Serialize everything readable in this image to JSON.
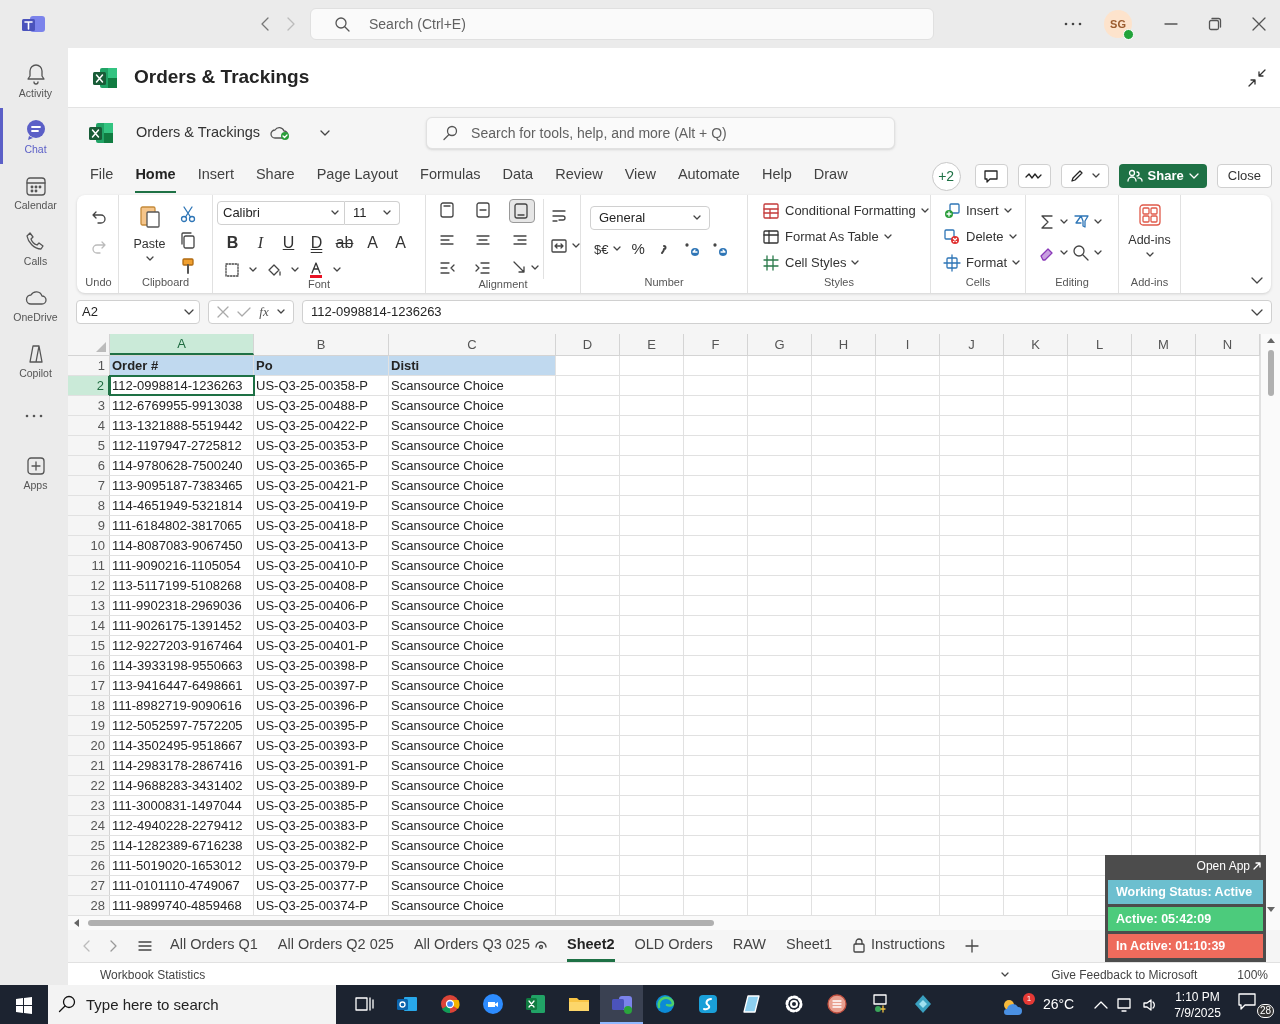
{
  "app_bar": {
    "search_placeholder": "Search (Ctrl+E)",
    "avatar_initials": "SG"
  },
  "rail": [
    {
      "label": "Activity",
      "selected": false
    },
    {
      "label": "Chat",
      "selected": true
    },
    {
      "label": "Calendar",
      "selected": false
    },
    {
      "label": "Calls",
      "selected": false
    },
    {
      "label": "OneDrive",
      "selected": false
    },
    {
      "label": "Copilot",
      "selected": false
    },
    {
      "label": "Apps",
      "selected": false
    }
  ],
  "header": {
    "title": "Orders & Trackings"
  },
  "workbook": {
    "name": "Orders & Trackings",
    "search_placeholder": "Search for tools, help, and more (Alt + Q)"
  },
  "menu_tabs": [
    {
      "label": "File",
      "selected": false
    },
    {
      "label": "Home",
      "selected": true
    },
    {
      "label": "Insert",
      "selected": false
    },
    {
      "label": "Share",
      "selected": false
    },
    {
      "label": "Page Layout",
      "selected": false
    },
    {
      "label": "Formulas",
      "selected": false
    },
    {
      "label": "Data",
      "selected": false
    },
    {
      "label": "Review",
      "selected": false
    },
    {
      "label": "View",
      "selected": false
    },
    {
      "label": "Automate",
      "selected": false
    },
    {
      "label": "Help",
      "selected": false
    },
    {
      "label": "Draw",
      "selected": false
    }
  ],
  "toolbar": {
    "coauthors": "+2",
    "share": "Share",
    "close": "Close"
  },
  "ribbon": {
    "paste": "Paste",
    "font_name": "Calibri",
    "font_size": "11",
    "font_buttons": [
      "B",
      "I",
      "U",
      "D",
      "ab",
      "A",
      "A"
    ],
    "number_format": "General",
    "currency": "$€",
    "percent": "%",
    "styles": [
      "Conditional Formatting",
      "Format As Table",
      "Cell Styles"
    ],
    "cells": [
      "Insert",
      "Delete",
      "Format"
    ],
    "addins": "Add-ins",
    "groups": [
      "Undo",
      "Clipboard",
      "Font",
      "Alignment",
      "Number",
      "Styles",
      "Cells",
      "Editing",
      "Add-ins"
    ]
  },
  "formula_bar": {
    "name_box": "A2",
    "fx": "fx",
    "value": "112-0998814-1236263"
  },
  "grid": {
    "columns": [
      {
        "label": "A",
        "selected": true
      },
      {
        "label": "B",
        "selected": false
      },
      {
        "label": "C",
        "selected": false
      },
      {
        "label": "D",
        "selected": false
      },
      {
        "label": "E",
        "selected": false
      },
      {
        "label": "F",
        "selected": false
      },
      {
        "label": "G",
        "selected": false
      },
      {
        "label": "H",
        "selected": false
      },
      {
        "label": "I",
        "selected": false
      },
      {
        "label": "J",
        "selected": false
      },
      {
        "label": "K",
        "selected": false
      },
      {
        "label": "L",
        "selected": false
      },
      {
        "label": "M",
        "selected": false
      },
      {
        "label": "N",
        "selected": false
      }
    ],
    "rows": [
      {
        "number": "1",
        "kind": "header",
        "selected": false,
        "cells": [
          "Order #",
          "Po",
          "Disti"
        ]
      },
      {
        "number": "2",
        "kind": "data",
        "selected": true,
        "cells": [
          "112-0998814-1236263",
          "US-Q3-25-00358-P",
          "Scansource Choice"
        ]
      },
      {
        "number": "3",
        "kind": "data",
        "selected": false,
        "cells": [
          "112-6769955-9913038",
          "US-Q3-25-00488-P",
          "Scansource Choice"
        ]
      },
      {
        "number": "4",
        "kind": "data",
        "selected": false,
        "cells": [
          "113-1321888-5519442",
          "US-Q3-25-00422-P",
          "Scansource Choice"
        ]
      },
      {
        "number": "5",
        "kind": "data",
        "selected": false,
        "cells": [
          "112-1197947-2725812",
          "US-Q3-25-00353-P",
          "Scansource Choice"
        ]
      },
      {
        "number": "6",
        "kind": "data",
        "selected": false,
        "cells": [
          "114-9780628-7500240",
          "US-Q3-25-00365-P",
          "Scansource Choice"
        ]
      },
      {
        "number": "7",
        "kind": "data",
        "selected": false,
        "cells": [
          "113-9095187-7383465",
          "US-Q3-25-00421-P",
          "Scansource Choice"
        ]
      },
      {
        "number": "8",
        "kind": "data",
        "selected": false,
        "cells": [
          "114-4651949-5321814",
          "US-Q3-25-00419-P",
          "Scansource Choice"
        ]
      },
      {
        "number": "9",
        "kind": "data",
        "selected": false,
        "cells": [
          "111-6184802-3817065",
          "US-Q3-25-00418-P",
          "Scansource Choice"
        ]
      },
      {
        "number": "10",
        "kind": "data",
        "selected": false,
        "cells": [
          "114-8087083-9067450",
          "US-Q3-25-00413-P",
          "Scansource Choice"
        ]
      },
      {
        "number": "11",
        "kind": "data",
        "selected": false,
        "cells": [
          "111-9090216-1105054",
          "US-Q3-25-00410-P",
          "Scansource Choice"
        ]
      },
      {
        "number": "12",
        "kind": "data",
        "selected": false,
        "cells": [
          "113-5117199-5108268",
          "US-Q3-25-00408-P",
          "Scansource Choice"
        ]
      },
      {
        "number": "13",
        "kind": "data",
        "selected": false,
        "cells": [
          "111-9902318-2969036",
          "US-Q3-25-00406-P",
          "Scansource Choice"
        ]
      },
      {
        "number": "14",
        "kind": "data",
        "selected": false,
        "cells": [
          "111-9026175-1391452",
          "US-Q3-25-00403-P",
          "Scansource Choice"
        ]
      },
      {
        "number": "15",
        "kind": "data",
        "selected": false,
        "cells": [
          "112-9227203-9167464",
          "US-Q3-25-00401-P",
          "Scansource Choice"
        ]
      },
      {
        "number": "16",
        "kind": "data",
        "selected": false,
        "cells": [
          "114-3933198-9550663",
          "US-Q3-25-00398-P",
          "Scansource Choice"
        ]
      },
      {
        "number": "17",
        "kind": "data",
        "selected": false,
        "cells": [
          "113-9416447-6498661",
          "US-Q3-25-00397-P",
          "Scansource Choice"
        ]
      },
      {
        "number": "18",
        "kind": "data",
        "selected": false,
        "cells": [
          "111-8982719-9090616",
          "US-Q3-25-00396-P",
          "Scansource Choice"
        ]
      },
      {
        "number": "19",
        "kind": "data",
        "selected": false,
        "cells": [
          "112-5052597-7572205",
          "US-Q3-25-00395-P",
          "Scansource Choice"
        ]
      },
      {
        "number": "20",
        "kind": "data",
        "selected": false,
        "cells": [
          "114-3502495-9518667",
          "US-Q3-25-00393-P",
          "Scansource Choice"
        ]
      },
      {
        "number": "21",
        "kind": "data",
        "selected": false,
        "cells": [
          "114-2983178-2867416",
          "US-Q3-25-00391-P",
          "Scansource Choice"
        ]
      },
      {
        "number": "22",
        "kind": "data",
        "selected": false,
        "cells": [
          "114-9688283-3431402",
          "US-Q3-25-00389-P",
          "Scansource Choice"
        ]
      },
      {
        "number": "23",
        "kind": "data",
        "selected": false,
        "cells": [
          "111-3000831-1497044",
          "US-Q3-25-00385-P",
          "Scansource Choice"
        ]
      },
      {
        "number": "24",
        "kind": "data",
        "selected": false,
        "cells": [
          "112-4940228-2279412",
          "US-Q3-25-00383-P",
          "Scansource Choice"
        ]
      },
      {
        "number": "25",
        "kind": "data",
        "selected": false,
        "cells": [
          "114-1282389-6716238",
          "US-Q3-25-00382-P",
          "Scansource Choice"
        ]
      },
      {
        "number": "26",
        "kind": "data",
        "selected": false,
        "cells": [
          "111-5019020-1653012",
          "US-Q3-25-00379-P",
          "Scansource Choice"
        ]
      },
      {
        "number": "27",
        "kind": "data",
        "selected": false,
        "cells": [
          "111-0101110-4749067",
          "US-Q3-25-00377-P",
          "Scansource Choice"
        ]
      },
      {
        "number": "28",
        "kind": "data",
        "selected": false,
        "cells": [
          "111-9899740-4859468",
          "US-Q3-25-00374-P",
          "Scansource Choice"
        ]
      }
    ]
  },
  "sheet_tabs": [
    {
      "label": "All Orders Q1",
      "kind": "plain",
      "selected": false
    },
    {
      "label": "All Orders Q2 025",
      "kind": "plain",
      "selected": false
    },
    {
      "label": "All Orders Q3 025",
      "kind": "viewed",
      "selected": false
    },
    {
      "label": "Sheet2",
      "kind": "plain",
      "selected": true
    },
    {
      "label": "OLD Orders",
      "kind": "plain",
      "selected": false
    },
    {
      "label": "RAW",
      "kind": "plain",
      "selected": false
    },
    {
      "label": "Sheet1",
      "kind": "plain",
      "selected": false
    },
    {
      "label": "Instructions",
      "kind": "locked",
      "selected": false
    }
  ],
  "status_bar": {
    "statistics": "Workbook Statistics",
    "feedback": "Give Feedback to Microsoft",
    "zoom": "100%"
  },
  "tracker": {
    "open_app": "Open App",
    "rows": [
      {
        "label": "Working Status: Active",
        "color": "#6cbfcf"
      },
      {
        "label": "Active: 05:42:09",
        "color": "#4ccb7c"
      },
      {
        "label": "In Active: 01:10:39",
        "color": "#ee6b5c"
      }
    ]
  },
  "taskbar": {
    "search_placeholder": "Type here to search",
    "weather_badge": "1",
    "temperature": "26°C",
    "time": "1:10 PM",
    "date": "7/9/2025",
    "notifications": "28",
    "apps": [
      {
        "selected": false
      },
      {
        "selected": false
      },
      {
        "selected": false
      },
      {
        "selected": false
      },
      {
        "selected": false
      },
      {
        "selected": false
      },
      {
        "selected": true
      },
      {
        "selected": false
      },
      {
        "selected": false
      },
      {
        "selected": false
      },
      {
        "selected": false
      },
      {
        "selected": false
      },
      {
        "selected": false
      },
      {
        "selected": false
      }
    ]
  }
}
